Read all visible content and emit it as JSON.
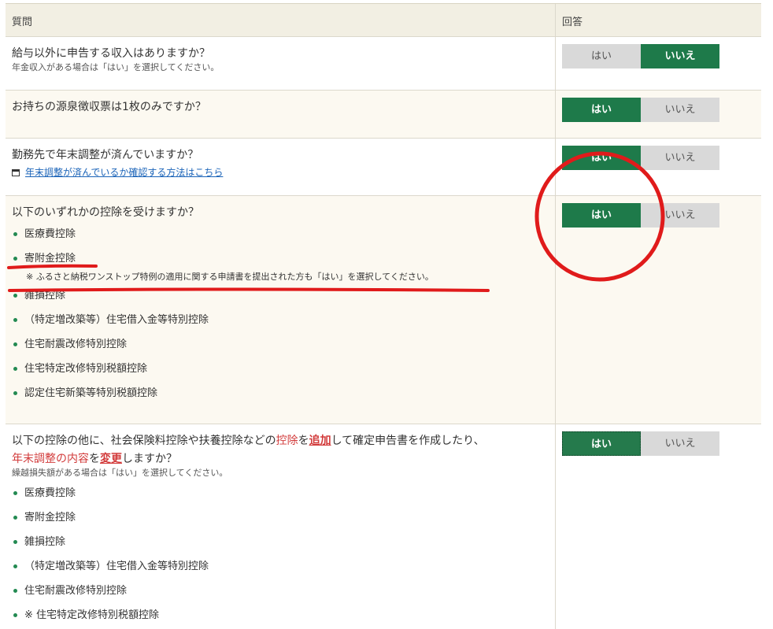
{
  "header": {
    "question": "質問",
    "answer": "回答"
  },
  "yes_label": "はい",
  "no_label": "いいえ",
  "q1": {
    "text": "給与以外に申告する収入はありますか？",
    "note": "年金収入がある場合は「はい」を選択してください。",
    "selected": "いいえ"
  },
  "q2": {
    "text": "お持ちの源泉徴収票は1枚のみですか？",
    "selected": "はい"
  },
  "q3": {
    "text": "勤務先で年末調整が済んでいますか？",
    "link": "年末調整が済んでいるか確認する方法はこちら",
    "selected": "はい"
  },
  "q4": {
    "text": "以下のいずれかの控除を受けますか？",
    "items": [
      "医療費控除",
      "寄附金控除",
      "雑損控除",
      "（特定増改築等）住宅借入金等特別控除",
      "住宅耐震改修特別控除",
      "住宅特定改修特別税額控除",
      "認定住宅新築等特別税額控除"
    ],
    "furusato_note": "※ ふるさと納税ワンストップ特例の適用に関する申請書を提出された方も「はい」を選択してください。",
    "selected": "はい"
  },
  "q5": {
    "line1_a": "以下の控除の他に、社会保険料控除や扶養控除などの",
    "line1_b": "控除",
    "line1_c": "を",
    "line1_d": "追加",
    "line1_e": "して確定申告書を作成したり、",
    "line2_a": "年末調整の内容",
    "line2_b": "を",
    "line2_c": "変更",
    "line2_d": "しますか？",
    "note": "繰越損失額がある場合は「はい」を選択してください。",
    "items": [
      "医療費控除",
      "寄附金控除",
      "雑損控除",
      "（特定増改築等）住宅借入金等特別控除",
      "住宅耐震改修特別控除"
    ],
    "partial_item": "※ 住宅特定改修特別税額控除",
    "selected": "はい"
  },
  "colors": {
    "selected": "#1e7a4a",
    "unselected": "#d9d9d9",
    "annotation": "#e01b1b",
    "bullet": "#238a52"
  }
}
